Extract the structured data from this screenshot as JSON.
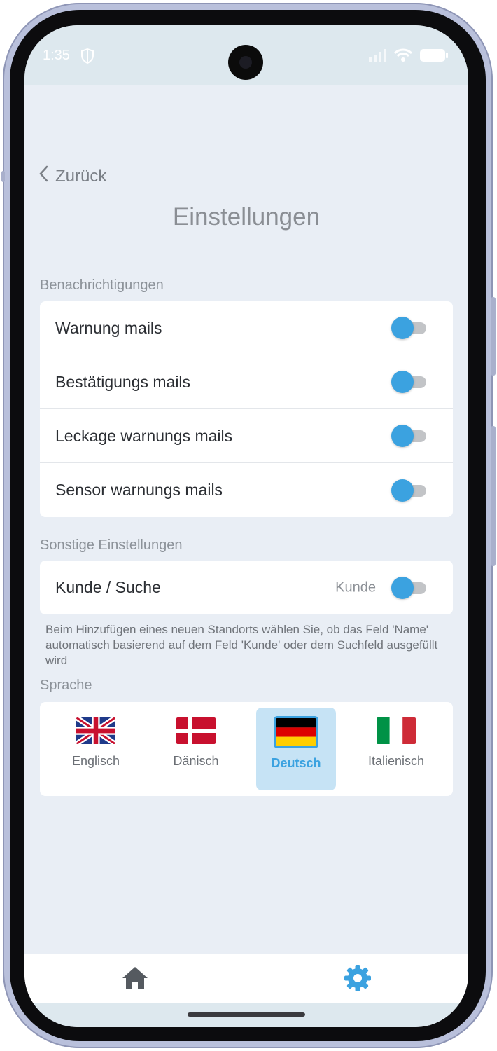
{
  "status_bar": {
    "time": "1:35"
  },
  "header": {
    "back_label": "Zurück",
    "title": "Einstellungen"
  },
  "notifications": {
    "section_label": "Benachrichtigungen",
    "items": [
      {
        "label": "Warnung mails",
        "enabled": true
      },
      {
        "label": "Bestätigungs mails",
        "enabled": true
      },
      {
        "label": "Leckage warnungs mails",
        "enabled": true
      },
      {
        "label": "Sensor warnungs mails",
        "enabled": true
      }
    ]
  },
  "other_settings": {
    "section_label": "Sonstige Einstellungen",
    "customer_search": {
      "label": "Kunde / Suche",
      "value": "Kunde",
      "enabled": true
    },
    "help_text": "Beim Hinzufügen eines neuen Standorts wählen Sie, ob das Feld 'Name' automatisch basierend auf dem Feld 'Kunde' oder dem Suchfeld ausgefüllt wird"
  },
  "language": {
    "section_label": "Sprache",
    "options": [
      {
        "label": "Englisch",
        "selected": false
      },
      {
        "label": "Dänisch",
        "selected": false
      },
      {
        "label": "Deutsch",
        "selected": true
      },
      {
        "label": "Italienisch",
        "selected": false
      }
    ]
  },
  "bottom_nav": {
    "items": [
      "home-icon",
      "settings-gear-icon"
    ],
    "active": "settings-gear-icon"
  },
  "colors": {
    "accent": "#3ba2e0",
    "background": "#e9eef5",
    "text": "#2b2e33"
  }
}
